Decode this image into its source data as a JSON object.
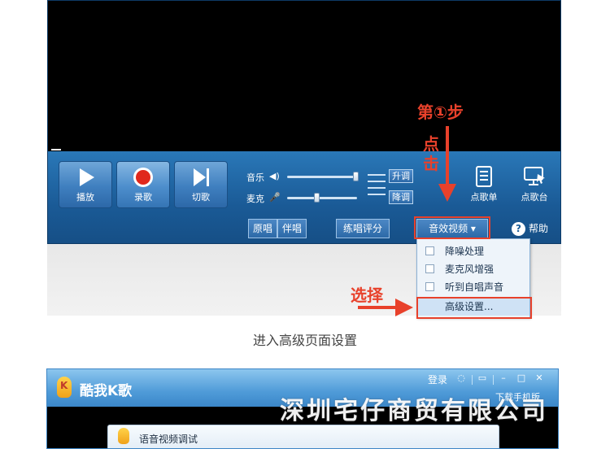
{
  "player": {
    "buttons": {
      "play": "播放",
      "record": "录歌",
      "skip": "切歌"
    },
    "music_label": "音乐",
    "mic_label": "麦克",
    "music_level": 0.98,
    "mic_level": 0.42,
    "pitch_up": "升调",
    "pitch_down": "降调",
    "playlist_label": "点歌单",
    "station_label": "点歌台",
    "original": "原唱",
    "accompany": "伴唱",
    "practice": "练唱评分",
    "effects": "音效视频",
    "help": "帮助"
  },
  "menu": {
    "items": [
      "降噪处理",
      "麦克风增强",
      "听到自唱声音"
    ],
    "advanced": "高级设置..."
  },
  "annotations": {
    "step1": "第①步",
    "click": "点击",
    "choose": "选择"
  },
  "caption": "进入高级页面设置",
  "window2": {
    "app_name": "酷我K歌",
    "login": "登录",
    "download": "下载手机版",
    "dialog_title": "语音视频调试"
  },
  "watermark": "深圳宅仔商贸有限公司",
  "colors": {
    "accent": "#e8412b",
    "panel": "#1b5e9a"
  }
}
